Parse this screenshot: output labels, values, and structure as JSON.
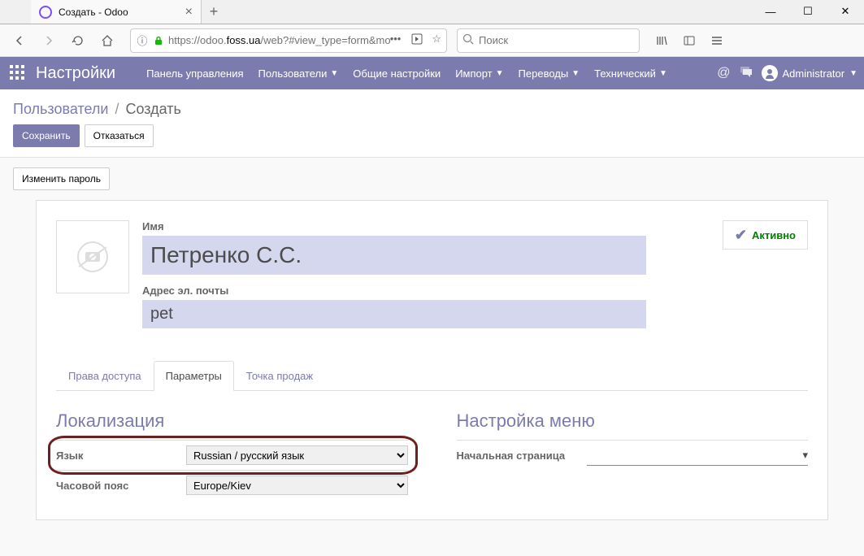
{
  "browser": {
    "tab_title": "Создать - Odoo",
    "url_prefix": "https://",
    "url_host_pre": "odoo.",
    "url_host_bold": "foss.ua",
    "url_path": "/web?#view_type=form&model=res",
    "search_placeholder": "Поиск"
  },
  "nav": {
    "brand": "Настройки",
    "items": [
      {
        "label": "Панель управления",
        "dropdown": false
      },
      {
        "label": "Пользователи",
        "dropdown": true
      },
      {
        "label": "Общие настройки",
        "dropdown": false
      },
      {
        "label": "Импорт",
        "dropdown": true
      },
      {
        "label": "Переводы",
        "dropdown": true
      },
      {
        "label": "Технический",
        "dropdown": true
      }
    ],
    "user": "Administrator"
  },
  "breadcrumb": {
    "parent": "Пользователи",
    "current": "Создать"
  },
  "buttons": {
    "save": "Сохранить",
    "discard": "Отказаться",
    "change_password": "Изменить пароль"
  },
  "form": {
    "name_label": "Имя",
    "name_value": "Петренко С.С.",
    "email_label": "Адрес эл. почты",
    "email_value": "pet",
    "active_label": "Активно"
  },
  "tabs": {
    "t0": "Права доступа",
    "t1": "Параметры",
    "t2": "Точка продаж"
  },
  "localization": {
    "title": "Локализация",
    "lang_label": "Язык",
    "lang_value": "Russian / русский язык",
    "tz_label": "Часовой пояс",
    "tz_value": "Europe/Kiev"
  },
  "menu_setup": {
    "title": "Настройка меню",
    "home_label": "Начальная страница"
  }
}
